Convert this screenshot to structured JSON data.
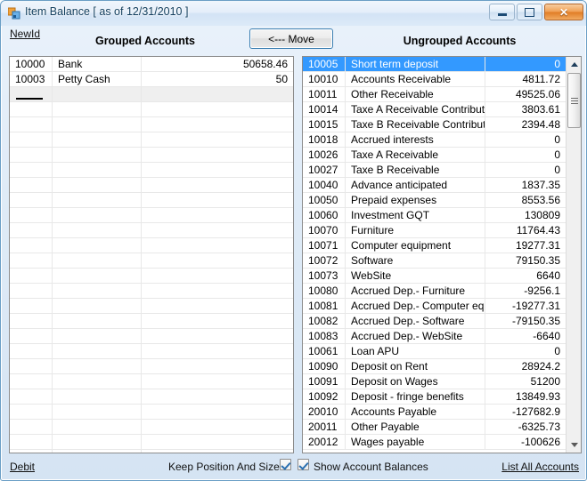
{
  "window": {
    "title": "Item Balance [ as of 12/31/2010 ]",
    "icon": "form-icon",
    "buttons": {
      "minimize": "minimize-icon",
      "maximize": "maximize-icon",
      "close": "✕"
    }
  },
  "toolbar": {
    "new_id_label": "NewId",
    "move_label": "<--- Move"
  },
  "panels": {
    "grouped_header": "Grouped Accounts",
    "ungrouped_header": "Ungrouped Accounts"
  },
  "grouped_accounts": {
    "rows": [
      {
        "id": "10000",
        "name": "Bank",
        "value": "50658.46"
      },
      {
        "id": "10003",
        "name": "Petty Cash",
        "value": "50"
      }
    ],
    "new_row_placeholder": ""
  },
  "ungrouped_accounts": {
    "selected_index": 0,
    "rows": [
      {
        "id": "10005",
        "name": "Short term deposit",
        "value": "0"
      },
      {
        "id": "10010",
        "name": "Accounts Receivable",
        "value": "4811.72"
      },
      {
        "id": "10011",
        "name": "Other Receivable",
        "value": "49525.06"
      },
      {
        "id": "10014",
        "name": "Taxe A Receivable Contribution",
        "value": "3803.61"
      },
      {
        "id": "10015",
        "name": "Taxe B Receivable Contribution",
        "value": "2394.48"
      },
      {
        "id": "10018",
        "name": "Accrued interests",
        "value": "0"
      },
      {
        "id": "10026",
        "name": "Taxe A Receivable",
        "value": "0"
      },
      {
        "id": "10027",
        "name": "Taxe B Receivable",
        "value": "0"
      },
      {
        "id": "10040",
        "name": "Advance anticipated",
        "value": "1837.35"
      },
      {
        "id": "10050",
        "name": "Prepaid expenses",
        "value": "8553.56"
      },
      {
        "id": "10060",
        "name": "Investment GQT",
        "value": "130809"
      },
      {
        "id": "10070",
        "name": "Furniture",
        "value": "11764.43"
      },
      {
        "id": "10071",
        "name": "Computer equipment",
        "value": "19277.31"
      },
      {
        "id": "10072",
        "name": "Software",
        "value": "79150.35"
      },
      {
        "id": "10073",
        "name": "WebSite",
        "value": "6640"
      },
      {
        "id": "10080",
        "name": "Accrued Dep.- Furniture",
        "value": "-9256.1"
      },
      {
        "id": "10081",
        "name": "Accrued Dep.- Computer equip.",
        "value": "-19277.31"
      },
      {
        "id": "10082",
        "name": "Accrued Dep.- Software",
        "value": "-79150.35"
      },
      {
        "id": "10083",
        "name": "Accrued Dep.- WebSite",
        "value": "-6640"
      },
      {
        "id": "10061",
        "name": "Loan APU",
        "value": "0"
      },
      {
        "id": "10090",
        "name": "Deposit on Rent",
        "value": "28924.2"
      },
      {
        "id": "10091",
        "name": "Deposit on Wages",
        "value": "51200"
      },
      {
        "id": "10092",
        "name": "Deposit - fringe benefits",
        "value": "13849.93"
      },
      {
        "id": "20010",
        "name": "Accounts Payable",
        "value": "-127682.9"
      },
      {
        "id": "20011",
        "name": "Other Payable",
        "value": "-6325.73"
      },
      {
        "id": "20012",
        "name": "Wages payable",
        "value": "-100626"
      }
    ],
    "scrollbar": {
      "up_arrow": "scroll-up-icon",
      "down_arrow": "scroll-down-icon"
    }
  },
  "statusbar": {
    "debit_label": "Debit",
    "keep_position_label": "Keep Position And Size",
    "keep_position_checked": true,
    "show_balances_label": "Show Account Balances",
    "show_balances_checked": true,
    "list_all_label": "List All Accounts"
  },
  "colors": {
    "selection": "#3399ff",
    "title_text": "#14405f",
    "window_border": "#6a9ec5",
    "close_button": "#e07c25"
  }
}
